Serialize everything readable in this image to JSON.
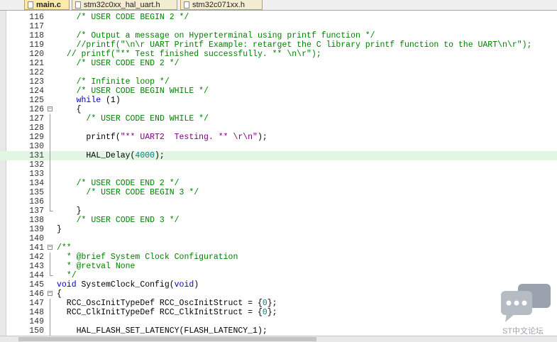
{
  "tabs": [
    {
      "label": "main.c",
      "state": "active"
    },
    {
      "label": "stm32c0xx_hal_uart.h",
      "state": "normal"
    },
    {
      "label": "stm32c071xx.h",
      "state": "normal"
    }
  ],
  "lines": [
    {
      "num": "116",
      "segs": [
        [
          "    ",
          ""
        ],
        [
          "/* USER CODE BEGIN 2 */",
          "cm"
        ]
      ]
    },
    {
      "num": "117",
      "segs": []
    },
    {
      "num": "118",
      "segs": [
        [
          "    ",
          ""
        ],
        [
          "/* Output a message on Hyperterminal using printf function */",
          "cm"
        ]
      ]
    },
    {
      "num": "119",
      "segs": [
        [
          "    ",
          ""
        ],
        [
          "//printf(\"\\n\\r UART Printf Example: retarget the C library printf function to the UART\\n\\r\");",
          "cm"
        ]
      ]
    },
    {
      "num": "120",
      "segs": [
        [
          "  ",
          ""
        ],
        [
          "// printf(\"** Test finished successfully. ** \\n\\r\");",
          "cm"
        ]
      ]
    },
    {
      "num": "121",
      "segs": [
        [
          "    ",
          ""
        ],
        [
          "/* USER CODE END 2 */",
          "cm"
        ]
      ]
    },
    {
      "num": "122",
      "segs": []
    },
    {
      "num": "123",
      "segs": [
        [
          "    ",
          ""
        ],
        [
          "/* Infinite loop */",
          "cm"
        ]
      ]
    },
    {
      "num": "124",
      "segs": [
        [
          "    ",
          ""
        ],
        [
          "/* USER CODE BEGIN WHILE */",
          "cm"
        ]
      ]
    },
    {
      "num": "125",
      "segs": [
        [
          "    ",
          ""
        ],
        [
          "while",
          "kw"
        ],
        [
          " (1)",
          ""
        ]
      ]
    },
    {
      "num": "126",
      "fold": "open",
      "segs": [
        [
          "    {",
          ""
        ]
      ]
    },
    {
      "num": "127",
      "fold": "line",
      "segs": [
        [
          "      ",
          ""
        ],
        [
          "/* USER CODE END WHILE */",
          "cm"
        ]
      ]
    },
    {
      "num": "128",
      "fold": "line",
      "segs": []
    },
    {
      "num": "129",
      "fold": "line",
      "segs": [
        [
          "      printf(",
          ""
        ],
        [
          "\"** UART2  Testing. ** \\r\\n\"",
          "str"
        ],
        [
          ");",
          ""
        ]
      ]
    },
    {
      "num": "130",
      "fold": "line",
      "segs": []
    },
    {
      "num": "131",
      "fold": "line",
      "highlight": true,
      "segs": [
        [
          "      HAL_Delay(",
          ""
        ],
        [
          "4000",
          "num"
        ],
        [
          ");",
          ""
        ]
      ]
    },
    {
      "num": "132",
      "fold": "line",
      "segs": []
    },
    {
      "num": "133",
      "fold": "line",
      "segs": []
    },
    {
      "num": "134",
      "fold": "line",
      "segs": [
        [
          "    ",
          ""
        ],
        [
          "/* USER CODE END 2 */",
          "cm"
        ]
      ]
    },
    {
      "num": "135",
      "fold": "line",
      "segs": [
        [
          "      ",
          ""
        ],
        [
          "/* USER CODE BEGIN 3 */",
          "cm"
        ]
      ]
    },
    {
      "num": "136",
      "fold": "line",
      "segs": []
    },
    {
      "num": "137",
      "fold": "end",
      "segs": [
        [
          "    }",
          ""
        ]
      ]
    },
    {
      "num": "138",
      "segs": [
        [
          "    ",
          ""
        ],
        [
          "/* USER CODE END 3 */",
          "cm"
        ]
      ]
    },
    {
      "num": "139",
      "segs": [
        [
          "}",
          ""
        ]
      ]
    },
    {
      "num": "140",
      "segs": []
    },
    {
      "num": "141",
      "fold": "open",
      "segs": [
        [
          "",
          ""
        ],
        [
          "/**",
          "cm"
        ]
      ]
    },
    {
      "num": "142",
      "fold": "line",
      "segs": [
        [
          "  ",
          ""
        ],
        [
          "* @brief System Clock Configuration",
          "cm"
        ]
      ]
    },
    {
      "num": "143",
      "fold": "line",
      "segs": [
        [
          "  ",
          ""
        ],
        [
          "* @retval None",
          "cm"
        ]
      ]
    },
    {
      "num": "144",
      "fold": "end",
      "segs": [
        [
          "  ",
          ""
        ],
        [
          "*/",
          "cm"
        ]
      ]
    },
    {
      "num": "145",
      "segs": [
        [
          "",
          ""
        ],
        [
          "void",
          "kw"
        ],
        [
          " SystemClock_Config(",
          ""
        ],
        [
          "void",
          "kw"
        ],
        [
          ")",
          ""
        ]
      ]
    },
    {
      "num": "146",
      "fold": "open",
      "segs": [
        [
          "{",
          ""
        ]
      ]
    },
    {
      "num": "147",
      "fold": "line",
      "segs": [
        [
          "  RCC_OscInitTypeDef RCC_OscInitStruct = {",
          ""
        ],
        [
          "0",
          "num"
        ],
        [
          "};",
          ""
        ]
      ]
    },
    {
      "num": "148",
      "fold": "line",
      "segs": [
        [
          "  RCC_ClkInitTypeDef RCC_ClkInitStruct = {",
          ""
        ],
        [
          "0",
          "num"
        ],
        [
          "};",
          ""
        ]
      ]
    },
    {
      "num": "149",
      "fold": "line",
      "segs": []
    },
    {
      "num": "150",
      "fold": "line",
      "segs": [
        [
          "    HAL_FLASH_SET_LATENCY(FLASH_LATENCY_1);",
          ""
        ]
      ]
    }
  ],
  "watermark": {
    "label": "ST中文论坛"
  },
  "colors": {
    "comment": "#008000",
    "keyword": "#0000c8",
    "string": "#800080",
    "number": "#008080",
    "current_line": "#e3f6e4"
  }
}
